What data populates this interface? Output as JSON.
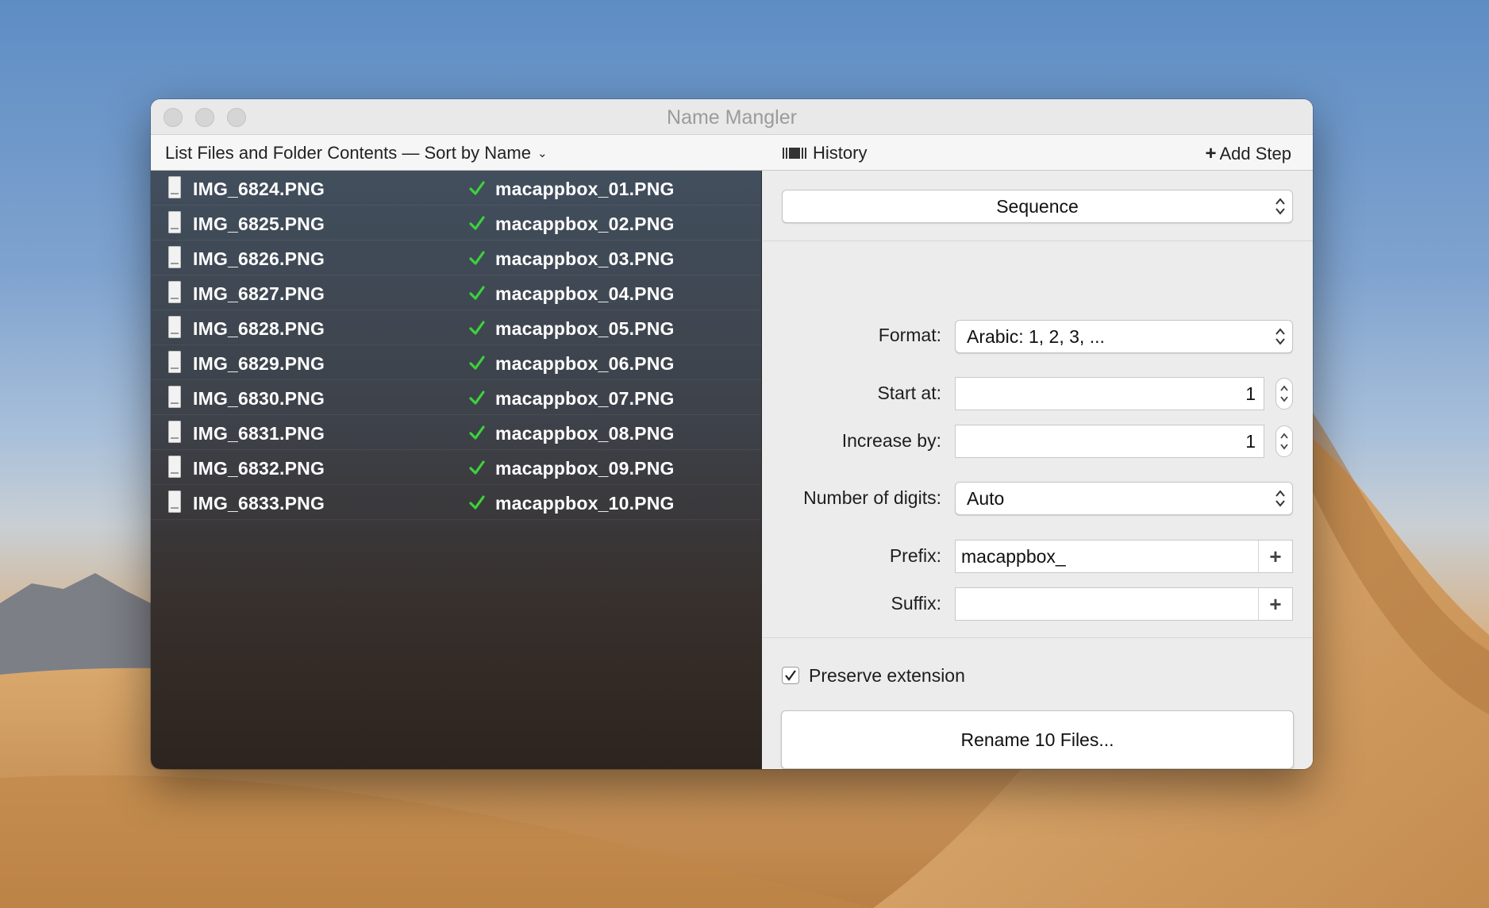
{
  "window": {
    "title": "Name Mangler"
  },
  "toolbar": {
    "list_menu_label": "List Files and Folder Contents — Sort by Name",
    "history_label": "History",
    "add_step_label": "Add Step"
  },
  "files": [
    {
      "original": "IMG_6824.PNG",
      "renamed": "macappbox_01.PNG"
    },
    {
      "original": "IMG_6825.PNG",
      "renamed": "macappbox_02.PNG"
    },
    {
      "original": "IMG_6826.PNG",
      "renamed": "macappbox_03.PNG"
    },
    {
      "original": "IMG_6827.PNG",
      "renamed": "macappbox_04.PNG"
    },
    {
      "original": "IMG_6828.PNG",
      "renamed": "macappbox_05.PNG"
    },
    {
      "original": "IMG_6829.PNG",
      "renamed": "macappbox_06.PNG"
    },
    {
      "original": "IMG_6830.PNG",
      "renamed": "macappbox_07.PNG"
    },
    {
      "original": "IMG_6831.PNG",
      "renamed": "macappbox_08.PNG"
    },
    {
      "original": "IMG_6832.PNG",
      "renamed": "macappbox_09.PNG"
    },
    {
      "original": "IMG_6833.PNG",
      "renamed": "macappbox_10.PNG"
    }
  ],
  "step": {
    "type": "Sequence",
    "format_label": "Format:",
    "format_value": "Arabic: 1, 2, 3, ...",
    "start_label": "Start at:",
    "start_value": "1",
    "increase_label": "Increase by:",
    "increase_value": "1",
    "digits_label": "Number of digits:",
    "digits_value": "Auto",
    "prefix_label": "Prefix:",
    "prefix_value": "macappbox_",
    "suffix_label": "Suffix:",
    "suffix_value": "",
    "preserve_label": "Preserve extension",
    "preserve_checked": true
  },
  "rename_button_label": "Rename 10 Files...",
  "colors": {
    "check": "#3bd23b",
    "accent": "#1e1e1e"
  }
}
